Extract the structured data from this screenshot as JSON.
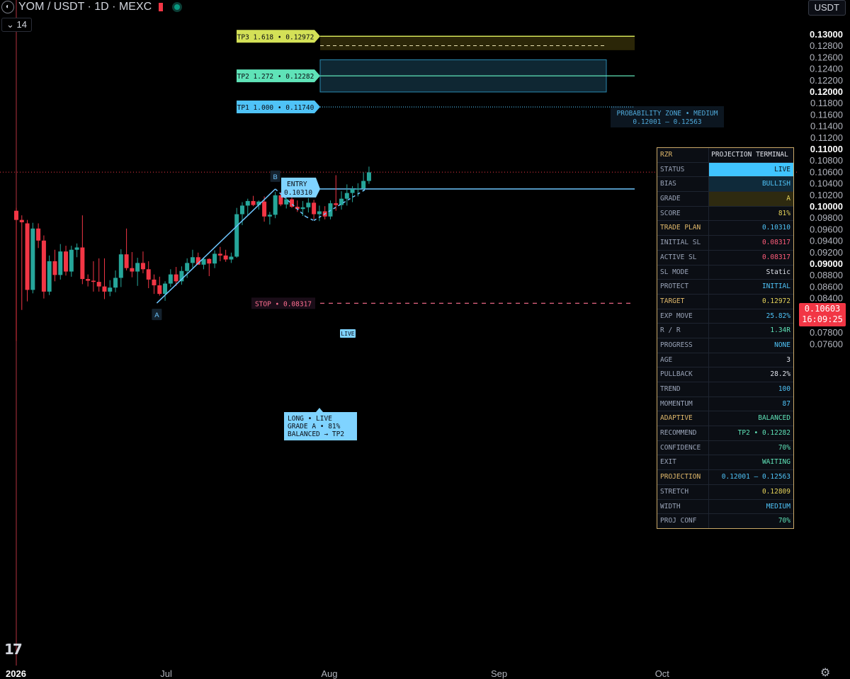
{
  "header": {
    "symbol_title": "YOM / USDT · 1D · MEXC",
    "indicator_count": "14",
    "currency": "USDT"
  },
  "price_label": {
    "price": "0.10603",
    "countdown": "16:09:25"
  },
  "chart_data": {
    "type": "candlestick",
    "y_axis": {
      "range": [
        0.075,
        0.1315
      ],
      "ticks": [
        "0.13000",
        "0.12800",
        "0.12600",
        "0.12400",
        "0.12200",
        "0.12000",
        "0.11800",
        "0.11600",
        "0.11400",
        "0.11200",
        "0.11000",
        "0.10800",
        "0.10600",
        "0.10400",
        "0.10200",
        "0.10000",
        "0.09800",
        "0.09600",
        "0.09400",
        "0.09200",
        "0.09000",
        "0.08800",
        "0.08600",
        "0.08400",
        "0.08200",
        "0.08000",
        "0.07800",
        "0.07600"
      ],
      "bold_ticks": [
        "0.13000",
        "0.12000",
        "0.11000",
        "0.10000",
        "0.09000",
        "0.08000"
      ]
    },
    "x_axis": {
      "labels": [
        {
          "text": "2026",
          "bold": true,
          "idx": 0
        },
        {
          "text": "Jul",
          "bold": false,
          "idx": 27.2
        },
        {
          "text": "Aug",
          "bold": false,
          "idx": 56.8
        },
        {
          "text": "Sep",
          "bold": false,
          "idx": 87.6
        },
        {
          "text": "Oct",
          "bold": false,
          "idx": 117.2
        }
      ]
    },
    "candles": [
      {
        "o": 0.0993,
        "h": 0.0998,
        "l": 0.0766,
        "c": 0.0977
      },
      {
        "o": 0.0977,
        "h": 0.0985,
        "l": 0.082,
        "c": 0.0973
      },
      {
        "o": 0.0971,
        "h": 0.0977,
        "l": 0.0835,
        "c": 0.0855
      },
      {
        "o": 0.0855,
        "h": 0.0972,
        "l": 0.0849,
        "c": 0.0962
      },
      {
        "o": 0.0962,
        "h": 0.0971,
        "l": 0.0928,
        "c": 0.0941
      },
      {
        "o": 0.0941,
        "h": 0.095,
        "l": 0.084,
        "c": 0.0852
      },
      {
        "o": 0.0852,
        "h": 0.0915,
        "l": 0.0846,
        "c": 0.0905
      },
      {
        "o": 0.0905,
        "h": 0.0925,
        "l": 0.087,
        "c": 0.0881
      },
      {
        "o": 0.0881,
        "h": 0.0935,
        "l": 0.0873,
        "c": 0.0922
      },
      {
        "o": 0.0922,
        "h": 0.0932,
        "l": 0.088,
        "c": 0.0887
      },
      {
        "o": 0.0887,
        "h": 0.0932,
        "l": 0.0878,
        "c": 0.0925
      },
      {
        "o": 0.0925,
        "h": 0.0936,
        "l": 0.0912,
        "c": 0.0929
      },
      {
        "o": 0.0929,
        "h": 0.0985,
        "l": 0.0865,
        "c": 0.0874
      },
      {
        "o": 0.0874,
        "h": 0.0882,
        "l": 0.0861,
        "c": 0.0871
      },
      {
        "o": 0.0871,
        "h": 0.0905,
        "l": 0.0852,
        "c": 0.0869
      },
      {
        "o": 0.0869,
        "h": 0.091,
        "l": 0.0852,
        "c": 0.0861
      },
      {
        "o": 0.0861,
        "h": 0.091,
        "l": 0.0839,
        "c": 0.0852
      },
      {
        "o": 0.0852,
        "h": 0.0872,
        "l": 0.0844,
        "c": 0.0859
      },
      {
        "o": 0.0859,
        "h": 0.0889,
        "l": 0.0851,
        "c": 0.0876
      },
      {
        "o": 0.0876,
        "h": 0.0926,
        "l": 0.086,
        "c": 0.0917
      },
      {
        "o": 0.0917,
        "h": 0.0962,
        "l": 0.0889,
        "c": 0.0893
      },
      {
        "o": 0.0893,
        "h": 0.0921,
        "l": 0.0877,
        "c": 0.0887
      },
      {
        "o": 0.0887,
        "h": 0.0911,
        "l": 0.0862,
        "c": 0.0902
      },
      {
        "o": 0.0902,
        "h": 0.0922,
        "l": 0.0884,
        "c": 0.0891
      },
      {
        "o": 0.0891,
        "h": 0.0905,
        "l": 0.0858,
        "c": 0.0873
      },
      {
        "o": 0.0873,
        "h": 0.0882,
        "l": 0.0848,
        "c": 0.0863
      },
      {
        "o": 0.0863,
        "h": 0.0878,
        "l": 0.0845,
        "c": 0.0848
      },
      {
        "o": 0.0848,
        "h": 0.087,
        "l": 0.0836,
        "c": 0.0866
      },
      {
        "o": 0.0866,
        "h": 0.0891,
        "l": 0.086,
        "c": 0.0882
      },
      {
        "o": 0.0882,
        "h": 0.0895,
        "l": 0.0862,
        "c": 0.087
      },
      {
        "o": 0.087,
        "h": 0.0896,
        "l": 0.0864,
        "c": 0.0888
      },
      {
        "o": 0.0888,
        "h": 0.091,
        "l": 0.0876,
        "c": 0.0902
      },
      {
        "o": 0.0902,
        "h": 0.0925,
        "l": 0.0894,
        "c": 0.0912
      },
      {
        "o": 0.0912,
        "h": 0.092,
        "l": 0.09,
        "c": 0.0899
      },
      {
        "o": 0.0899,
        "h": 0.0912,
        "l": 0.0891,
        "c": 0.0909
      },
      {
        "o": 0.0909,
        "h": 0.091,
        "l": 0.0879,
        "c": 0.0901
      },
      {
        "o": 0.0901,
        "h": 0.0924,
        "l": 0.0893,
        "c": 0.0918
      },
      {
        "o": 0.0918,
        "h": 0.093,
        "l": 0.0905,
        "c": 0.0915
      },
      {
        "o": 0.0915,
        "h": 0.0925,
        "l": 0.0904,
        "c": 0.0908
      },
      {
        "o": 0.0908,
        "h": 0.092,
        "l": 0.0902,
        "c": 0.0913
      },
      {
        "o": 0.0913,
        "h": 0.0998,
        "l": 0.0911,
        "c": 0.0987
      },
      {
        "o": 0.0987,
        "h": 0.1008,
        "l": 0.0968,
        "c": 0.1002
      },
      {
        "o": 0.1002,
        "h": 0.1014,
        "l": 0.0985,
        "c": 0.101
      },
      {
        "o": 0.101,
        "h": 0.1019,
        "l": 0.1001,
        "c": 0.1003
      },
      {
        "o": 0.1003,
        "h": 0.1011,
        "l": 0.0995,
        "c": 0.1009
      },
      {
        "o": 0.1009,
        "h": 0.1018,
        "l": 0.0974,
        "c": 0.0983
      },
      {
        "o": 0.0983,
        "h": 0.0991,
        "l": 0.0969,
        "c": 0.0986
      },
      {
        "o": 0.0986,
        "h": 0.1026,
        "l": 0.098,
        "c": 0.102
      },
      {
        "o": 0.102,
        "h": 0.1025,
        "l": 0.1001,
        "c": 0.1004
      },
      {
        "o": 0.1004,
        "h": 0.1016,
        "l": 0.0997,
        "c": 0.1013
      },
      {
        "o": 0.1013,
        "h": 0.1019,
        "l": 0.0998,
        "c": 0.1
      },
      {
        "o": 0.1,
        "h": 0.1011,
        "l": 0.0991,
        "c": 0.0996
      },
      {
        "o": 0.0996,
        "h": 0.101,
        "l": 0.0984,
        "c": 0.0999
      },
      {
        "o": 0.0999,
        "h": 0.1015,
        "l": 0.099,
        "c": 0.1007
      },
      {
        "o": 0.1007,
        "h": 0.1012,
        "l": 0.0978,
        "c": 0.0987
      },
      {
        "o": 0.0987,
        "h": 0.1002,
        "l": 0.0975,
        "c": 0.0992
      },
      {
        "o": 0.0992,
        "h": 0.1001,
        "l": 0.0978,
        "c": 0.0983
      },
      {
        "o": 0.0983,
        "h": 0.1011,
        "l": 0.0978,
        "c": 0.1006
      },
      {
        "o": 0.1006,
        "h": 0.1055,
        "l": 0.0993,
        "c": 0.1003
      },
      {
        "o": 0.1003,
        "h": 0.1027,
        "l": 0.0995,
        "c": 0.1014
      },
      {
        "o": 0.1014,
        "h": 0.1039,
        "l": 0.1002,
        "c": 0.1024
      },
      {
        "o": 0.1024,
        "h": 0.1036,
        "l": 0.1008,
        "c": 0.1031
      },
      {
        "o": 0.1031,
        "h": 0.1041,
        "l": 0.1018,
        "c": 0.1032
      },
      {
        "o": 0.1032,
        "h": 0.106,
        "l": 0.1027,
        "c": 0.1045
      },
      {
        "o": 0.1045,
        "h": 0.107,
        "l": 0.104,
        "c": 0.106
      }
    ],
    "zigzag": [
      {
        "label": "A",
        "idx": 25.5,
        "price": 0.0832
      },
      {
        "label": "B",
        "idx": 47,
        "price": 0.1031
      },
      {
        "label": "",
        "idx": 52.5,
        "price": 0.0983
      },
      {
        "label": "",
        "idx": 54,
        "price": 0.0976
      },
      {
        "label": "",
        "idx": 63.5,
        "price": 0.1031
      }
    ],
    "levels": [
      {
        "name": "TP3",
        "text": "TP3  1.618  •  0.12972",
        "price": 0.12972,
        "color": "#d4e157"
      },
      {
        "name": "TP2",
        "text": "TP2  1.272  •  0.12282",
        "price": 0.12282,
        "color": "#5fe3b8"
      },
      {
        "name": "TP1",
        "text": "TP1  1.000  •  0.11740",
        "price": 0.1174,
        "color": "#4fc3f7"
      },
      {
        "name": "ENTRY",
        "text": "",
        "price": 0.1031,
        "color": "#6ec6ff"
      },
      {
        "name": "STOP",
        "text": "STOP  •  0.08317",
        "price": 0.08317,
        "color": "#ff6f91"
      }
    ],
    "stretch_price": 0.12809,
    "probability_zone": {
      "low": 0.12001,
      "high": 0.12563,
      "label": "PROBABILITY ZONE  •  MEDIUM",
      "range": "0.12001 — 0.12563"
    },
    "entry_label": {
      "line1": "ENTRY",
      "line2": "0.10310"
    },
    "long_label": {
      "line1": "LONG  •  LIVE",
      "line2": "GRADE A  •  81%",
      "line3": "BALANCED  →  TP2"
    },
    "live_tag": "LIVE",
    "current_price": 0.10603
  },
  "terminal": {
    "header_key": "RZR",
    "header_value": "PROJECTION TERMINAL",
    "rows": [
      {
        "k": "STATUS",
        "v": "LIVE",
        "kc": "#9aa4b8",
        "vc": "#0b0e14",
        "bg": "#40c4ff"
      },
      {
        "k": "BIAS",
        "v": "BULLISH",
        "kc": "#9aa4b8",
        "vc": "#4fc3f7",
        "bg": "#0f2a3a"
      },
      {
        "k": "GRADE",
        "v": "A",
        "kc": "#9aa4b8",
        "vc": "#e6d35a",
        "bg": "#2e2a10"
      },
      {
        "k": "SCORE",
        "v": "81%",
        "kc": "#9aa4b8",
        "vc": "#e6d35a",
        "bg": ""
      },
      {
        "k": "TRADE PLAN",
        "v": "0.10310",
        "kc": "#e0b86a",
        "vc": "#4fc3f7",
        "bg": ""
      },
      {
        "k": "INITIAL SL",
        "v": "0.08317",
        "kc": "#9aa4b8",
        "vc": "#ff5c7a",
        "bg": ""
      },
      {
        "k": "ACTIVE SL",
        "v": "0.08317",
        "kc": "#9aa4b8",
        "vc": "#ff5c7a",
        "bg": ""
      },
      {
        "k": "SL MODE",
        "v": "Static",
        "kc": "#9aa4b8",
        "vc": "#e0e3eb",
        "bg": ""
      },
      {
        "k": "PROTECT",
        "v": "INITIAL",
        "kc": "#9aa4b8",
        "vc": "#4fc3f7",
        "bg": ""
      },
      {
        "k": "TARGET",
        "v": "0.12972",
        "kc": "#e0b86a",
        "vc": "#e6d35a",
        "bg": ""
      },
      {
        "k": "EXP MOVE",
        "v": "25.82%",
        "kc": "#9aa4b8",
        "vc": "#4fc3f7",
        "bg": ""
      },
      {
        "k": "R / R",
        "v": "1.34R",
        "kc": "#9aa4b8",
        "vc": "#5fe3b8",
        "bg": ""
      },
      {
        "k": "PROGRESS",
        "v": "NONE",
        "kc": "#9aa4b8",
        "vc": "#4fc3f7",
        "bg": ""
      },
      {
        "k": "AGE",
        "v": "3",
        "kc": "#9aa4b8",
        "vc": "#e0e3eb",
        "bg": ""
      },
      {
        "k": "PULLBACK",
        "v": "28.2%",
        "kc": "#9aa4b8",
        "vc": "#e0e3eb",
        "bg": ""
      },
      {
        "k": "TREND",
        "v": "100",
        "kc": "#9aa4b8",
        "vc": "#4fc3f7",
        "bg": ""
      },
      {
        "k": "MOMENTUM",
        "v": "87",
        "kc": "#9aa4b8",
        "vc": "#4fc3f7",
        "bg": ""
      },
      {
        "k": "ADAPTIVE",
        "v": "BALANCED",
        "kc": "#e0b86a",
        "vc": "#5fe3b8",
        "bg": ""
      },
      {
        "k": "RECOMMEND",
        "v": "TP2  •  0.12282",
        "kc": "#9aa4b8",
        "vc": "#5fe3b8",
        "bg": ""
      },
      {
        "k": "CONFIDENCE",
        "v": "70%",
        "kc": "#9aa4b8",
        "vc": "#5fe3b8",
        "bg": ""
      },
      {
        "k": "EXIT",
        "v": "WAITING",
        "kc": "#9aa4b8",
        "vc": "#5fe3b8",
        "bg": ""
      },
      {
        "k": "PROJECTION",
        "v": "0.12001 — 0.12563",
        "kc": "#e0b86a",
        "vc": "#4fc3f7",
        "bg": ""
      },
      {
        "k": "STRETCH",
        "v": "0.12809",
        "kc": "#9aa4b8",
        "vc": "#e6d35a",
        "bg": ""
      },
      {
        "k": "WIDTH",
        "v": "MEDIUM",
        "kc": "#9aa4b8",
        "vc": "#4fc3f7",
        "bg": ""
      },
      {
        "k": "PROJ CONF",
        "v": "70%",
        "kc": "#9aa4b8",
        "vc": "#5fe3b8",
        "bg": ""
      }
    ]
  },
  "colors": {
    "up": "#26a69a",
    "down": "#f23645",
    "accent": "#4fc3f7",
    "border_gold": "#c9a868"
  }
}
